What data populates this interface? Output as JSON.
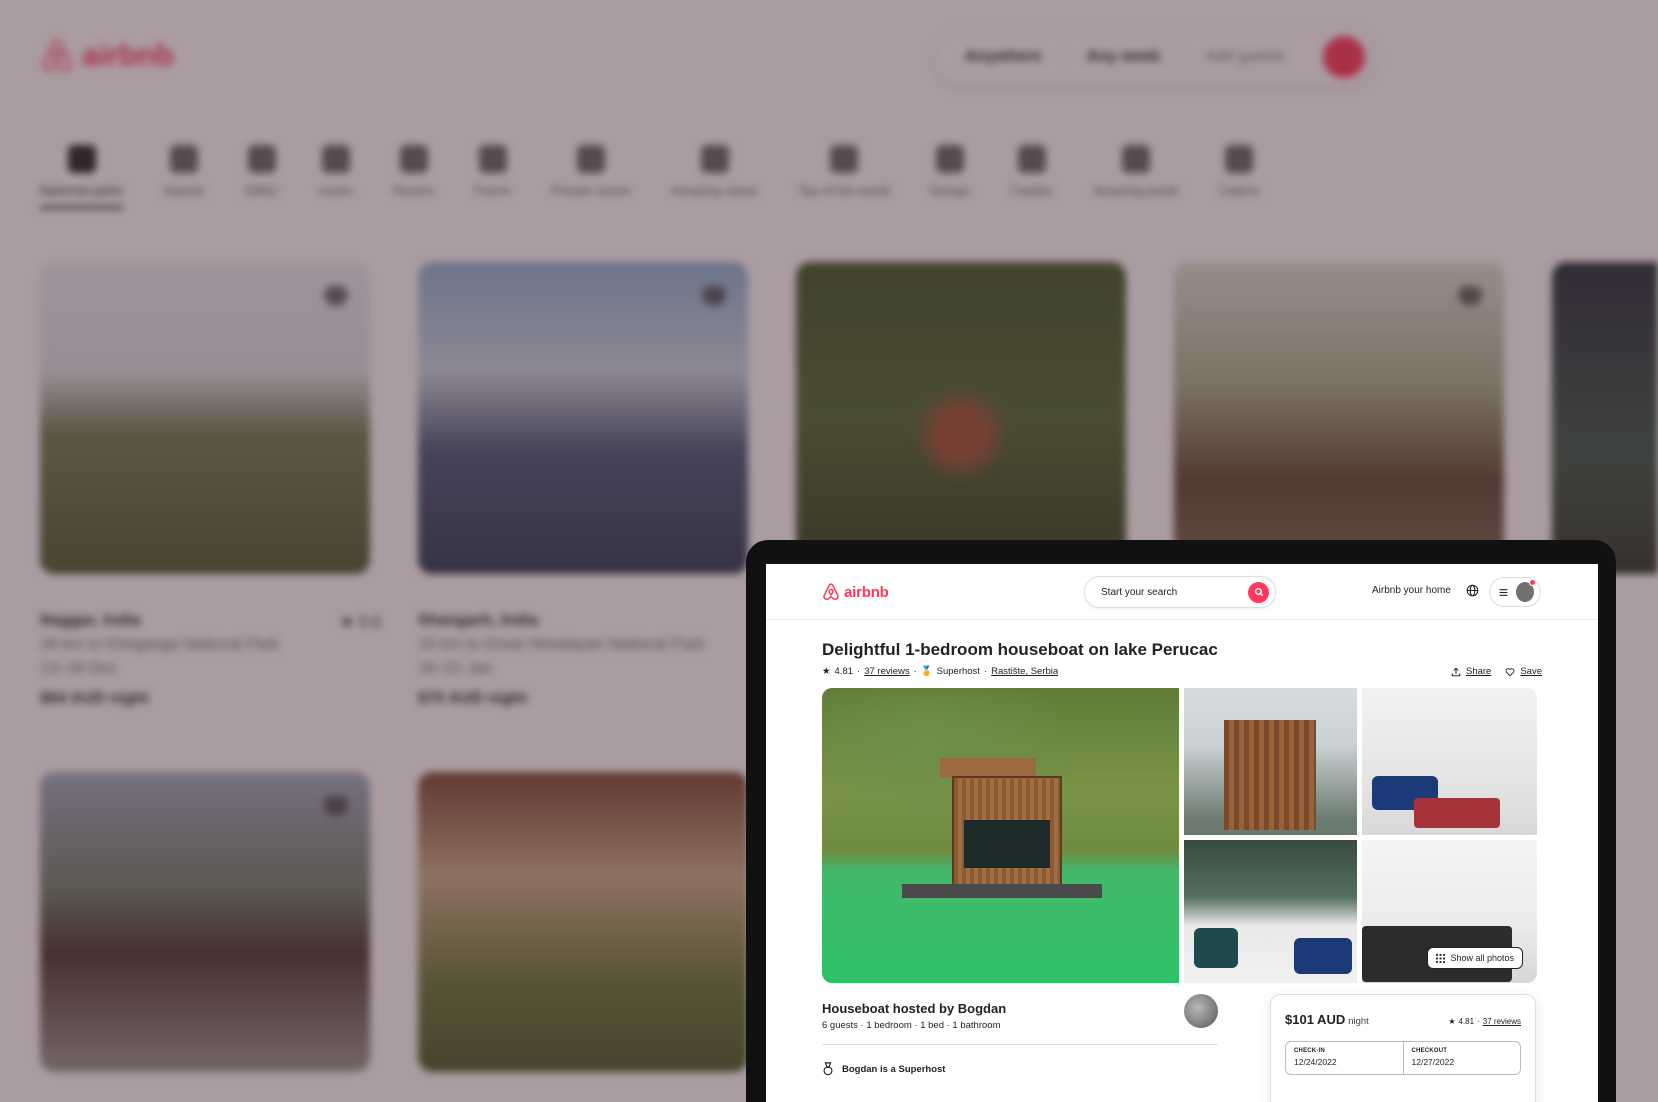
{
  "background": {
    "search": {
      "segment1": "Anywhere",
      "segment2": "Any week",
      "segment3": "Add guests"
    },
    "categories": [
      "National parks",
      "Islands",
      "OMG!",
      "Iconic",
      "Rooms",
      "Farms",
      "Private rooms",
      "Amazing views",
      "Top of the world",
      "Design",
      "Castles",
      "Amazing pools",
      "Cabins"
    ],
    "listings": [
      {
        "title": "Naggar, India",
        "subtitle": "28 km to Khirganga National Park",
        "dates": "13–18 Dec",
        "price": "$64 AUD night",
        "rating": "5.0"
      },
      {
        "title": "Shangarh, India",
        "subtitle": "19 km to Great Himalayan National Park",
        "dates": "16–21 Jan",
        "price": "$70 AUD night"
      }
    ]
  },
  "nav": {
    "brand": "airbnb",
    "search_placeholder": "Start your search",
    "host_link": "Airbnb your home"
  },
  "listing": {
    "title": "Delightful 1-bedroom houseboat on lake Perucac",
    "rating": "4.81",
    "reviews": "37 reviews",
    "superhost": "Superhost",
    "location": "Rastište, Serbia",
    "share": "Share",
    "save": "Save",
    "show_all_photos": "Show all photos",
    "hosted_by": "Houseboat hosted by Bogdan",
    "details": "6 guests · 1 bedroom · 1 bed · 1 bathroom",
    "superhost_line": "Bogdan is a Superhost"
  },
  "booking": {
    "price": "$101 AUD",
    "unit": "night",
    "rating": "4.81",
    "reviews": "37 reviews",
    "checkin_label": "CHECK-IN",
    "checkin": "12/24/2022",
    "checkout_label": "CHECKOUT",
    "checkout": "12/27/2022"
  },
  "colors": {
    "brand": "#ff385c",
    "text": "#222222",
    "muted": "#717171"
  }
}
